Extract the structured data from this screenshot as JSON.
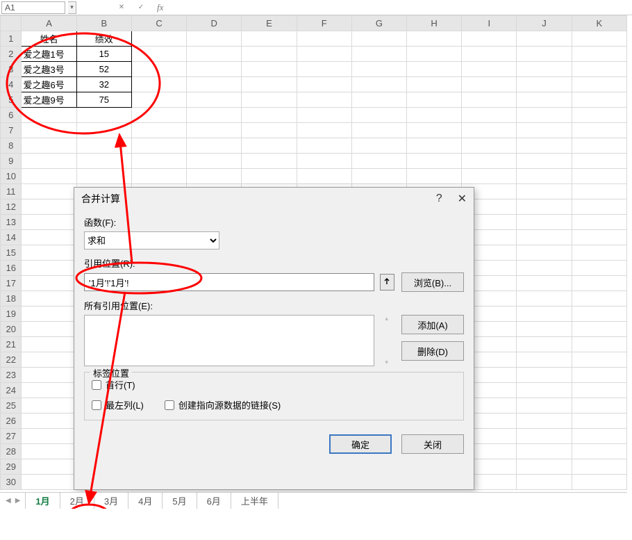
{
  "fxbar": {
    "name_box": "A1",
    "caret": "▾",
    "btn_cancel": "✕",
    "btn_confirm": "✓",
    "fx": "fx"
  },
  "columns": [
    "A",
    "B",
    "C",
    "D",
    "E",
    "F",
    "G",
    "H",
    "I",
    "J",
    "K"
  ],
  "row_count": 30,
  "headers": {
    "col_a": "姓名",
    "col_b": "绩效"
  },
  "rows": [
    {
      "name": "爱之趣1号",
      "perf": "15"
    },
    {
      "name": "爱之趣3号",
      "perf": "52"
    },
    {
      "name": "爱之趣6号",
      "perf": "32"
    },
    {
      "name": "爱之趣9号",
      "perf": "75"
    }
  ],
  "dialog": {
    "title": "合并计算",
    "help": "?",
    "close": "✕",
    "func_label": "函数(F):",
    "func_value": "求和",
    "ref_label": "引用位置(R):",
    "ref_value": "'1月'!'1月'!",
    "browse": "浏览(B)...",
    "all_refs_label": "所有引用位置(E):",
    "add": "添加(A)",
    "delete": "删除(D)",
    "group_title": "标签位置",
    "chk_first_row": "首行(T)",
    "chk_left_col": "最左列(L)",
    "chk_links": "创建指向源数据的链接(S)",
    "ok": "确定",
    "cancel": "关闭"
  },
  "tabs": {
    "nav_prev": "◀",
    "nav_next": "▶",
    "items": [
      "1月",
      "2月",
      "3月",
      "4月",
      "5月",
      "6月",
      "上半年"
    ],
    "active_index": 0
  },
  "colors": {
    "accent": "#107c41",
    "annotation": "#ff0000"
  }
}
